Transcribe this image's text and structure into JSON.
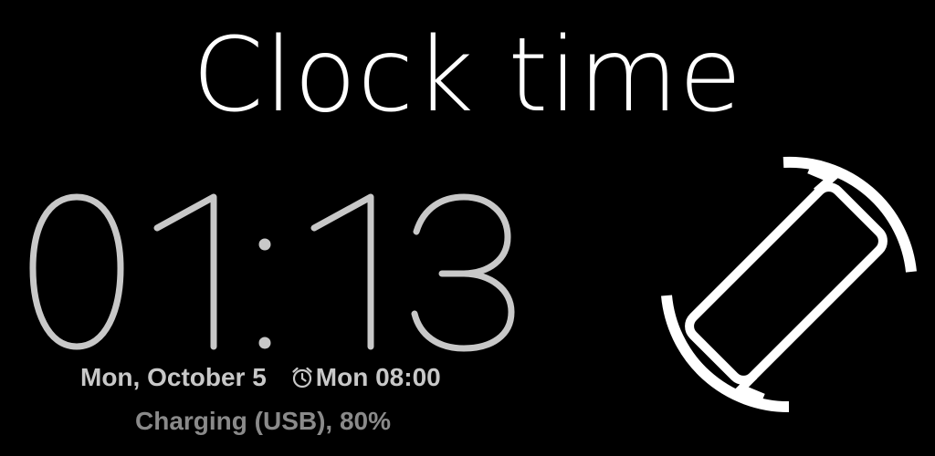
{
  "app": {
    "title": "Clock time"
  },
  "clock": {
    "time": "01:13",
    "digits": [
      "0",
      "1",
      ":",
      "1",
      "3"
    ]
  },
  "status": {
    "date": "Mon, October 5",
    "alarm": "Mon 08:00",
    "charging": "Charging (USB), 80%"
  },
  "icons": {
    "alarm": "alarm-clock-icon",
    "rotate": "screen-rotation-icon"
  },
  "colors": {
    "background": "#000000",
    "title": "#ffffff",
    "clock_digits": "#c8c8c8",
    "date_text": "#c8c8c8",
    "charging_text": "#8a8a8a",
    "icon": "#ffffff"
  }
}
